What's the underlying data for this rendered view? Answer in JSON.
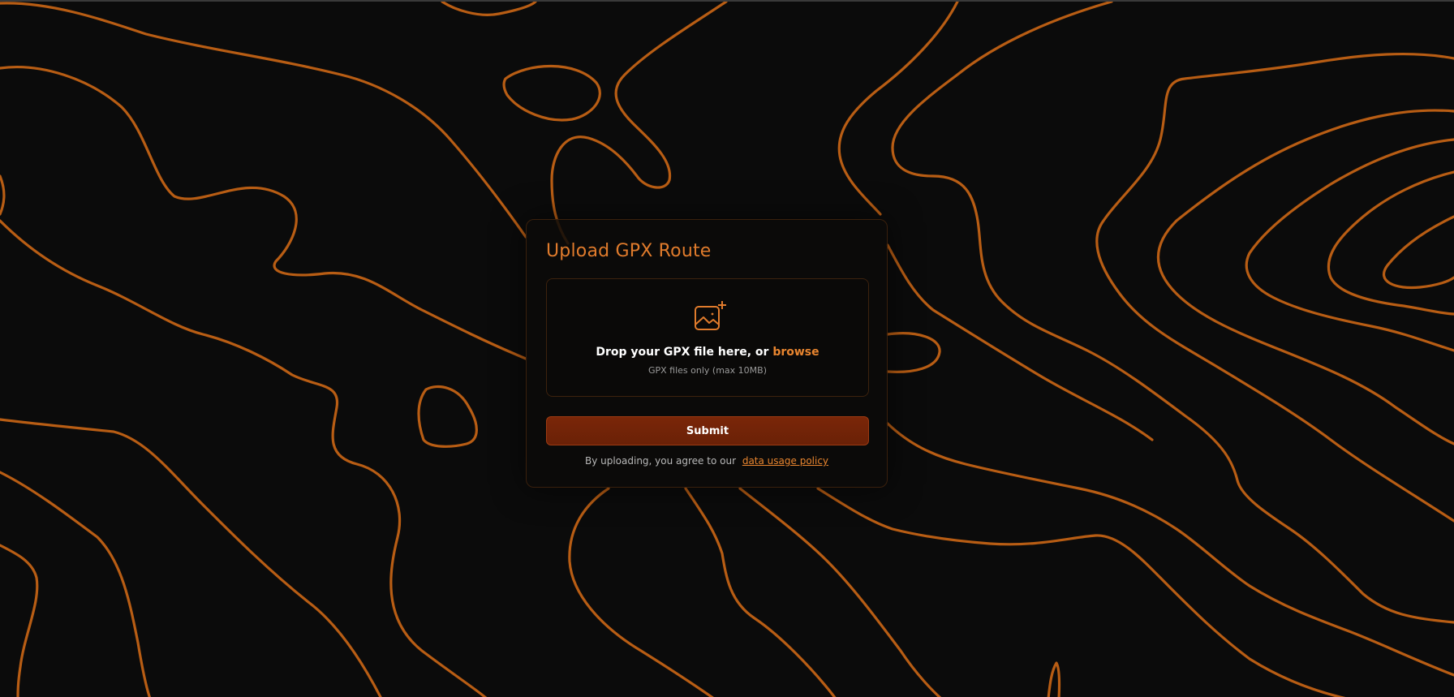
{
  "upload_card": {
    "title": "Upload GPX Route",
    "dropzone": {
      "prompt": "Drop your GPX file here, or ",
      "browse_label": "browse",
      "hint": "GPX files only (max 10MB)",
      "icon": "image-add-icon"
    },
    "submit_label": "Submit",
    "agreement_text": "By uploading, you agree to our",
    "policy_link_label": "data usage policy"
  },
  "colors": {
    "background": "#0b0b0b",
    "contour_lines": "#b85d14",
    "accent": "#e07b2c",
    "button": "#6e2307"
  }
}
